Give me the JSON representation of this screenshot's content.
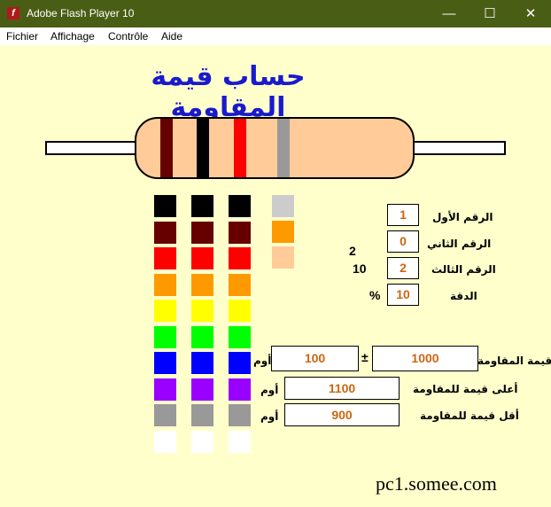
{
  "window": {
    "title": "Adobe Flash Player 10",
    "icon": "flash-icon",
    "controls": {
      "minimize": "—",
      "maximize": "☐",
      "close": "✕"
    }
  },
  "menu": {
    "items": [
      {
        "label": "Fichier"
      },
      {
        "label": "Affichage"
      },
      {
        "label": "Contrôle"
      },
      {
        "label": "Aide"
      }
    ]
  },
  "app": {
    "title": "حساب قيمة المقاومة",
    "resistor": {
      "body_color": "#ffcc99",
      "bands": [
        "#660000",
        "#000000",
        "#ff0000",
        "#999999"
      ]
    },
    "digit_columns": [
      [
        "#000000",
        "#660000",
        "#ff0000",
        "#ff9900",
        "#ffff00",
        "#00ff00",
        "#0000ff",
        "#9900ff",
        "#999999",
        "#ffffff"
      ],
      [
        "#000000",
        "#660000",
        "#ff0000",
        "#ff9900",
        "#ffff00",
        "#00ff00",
        "#0000ff",
        "#9900ff",
        "#999999",
        "#ffffff"
      ],
      [
        "#000000",
        "#660000",
        "#ff0000",
        "#ff9900",
        "#ffff00",
        "#00ff00",
        "#0000ff",
        "#9900ff",
        "#999999",
        "#ffffff"
      ]
    ],
    "tolerance_colors": [
      "#cccccc",
      "#ff9900",
      "#ffcc99"
    ],
    "fields": {
      "first_digit": {
        "label": "الرقم الأول",
        "value": "1"
      },
      "second_digit": {
        "label": "الرقم الثاني",
        "value": "0"
      },
      "third_digit": {
        "label": "الرقم الثالث",
        "value": "2",
        "power": "2",
        "base": "10"
      },
      "tolerance": {
        "label": "الدقة",
        "value": "10",
        "unit": "%"
      }
    },
    "resistance": {
      "label": "قيمة المقاومة",
      "value": "1000",
      "plusminus": "±",
      "deviation": "100",
      "unit": "أوم"
    },
    "max_resistance": {
      "label": "أعلى قيمة للمقاومة",
      "value": "1100",
      "unit": "أوم"
    },
    "min_resistance": {
      "label": "أقل قيمة للمقاومة",
      "value": "900",
      "unit": "أوم"
    },
    "site": "pc1.somee.com"
  }
}
